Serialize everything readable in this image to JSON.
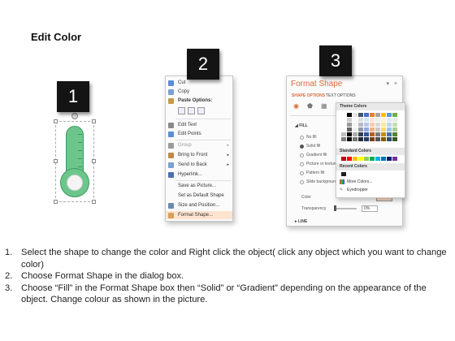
{
  "title": "Edit Color",
  "badges": [
    "1",
    "2",
    "3"
  ],
  "context_menu": {
    "items": [
      {
        "label": "Cut",
        "color": "#5a8ed6"
      },
      {
        "label": "Copy",
        "color": "#7aa0d0"
      },
      {
        "label": "Paste Options:",
        "color": "#c69a4a",
        "bold": true
      },
      {
        "label": "Edit Text",
        "color": "#8a8a8a"
      },
      {
        "label": "Edit Points",
        "color": "#5a8ed6"
      },
      {
        "label": "Group",
        "color": "#9a9a9a",
        "disabled": true,
        "arrow": "▸"
      },
      {
        "label": "Bring to Front",
        "color": "#c08a4a",
        "arrow": "▸"
      },
      {
        "label": "Send to Back",
        "color": "#7aa0d0",
        "arrow": "▸"
      },
      {
        "label": "Hyperlink...",
        "color": "#4a70b0"
      },
      {
        "label": "Save as Picture...",
        "color": ""
      },
      {
        "label": "Set as Default Shape",
        "color": ""
      },
      {
        "label": "Size and Position...",
        "color": "#6a8ab0"
      },
      {
        "label": "Format Shape...",
        "color": "#d8a05a",
        "highlight": true
      }
    ]
  },
  "format_pane": {
    "title": "Format Shape",
    "controls": "▾ ×",
    "tabs": [
      "SHAPE OPTIONS",
      "TEXT OPTIONS"
    ],
    "fill_section": "◢ FILL",
    "fill_options": [
      "No fill",
      "Solid fill",
      "Gradient fill",
      "Picture or texture fill",
      "Pattern fill",
      "Slide background fill"
    ],
    "selected_fill": 1,
    "color_label": "Color",
    "transparency_label": "Transparency",
    "transparency_value": "0%",
    "line_section": "▸ LINE"
  },
  "color_popup": {
    "theme_header": "Theme Colors",
    "standard_header": "Standard Colors",
    "recent_header": "Recent Colors",
    "more_colors": "More Colors...",
    "eyedropper": "Eyedropper",
    "theme_top": [
      "#ffffff",
      "#000000",
      "#e7e6e6",
      "#44546a",
      "#4472c4",
      "#ed7d31",
      "#a5a5a5",
      "#ffc000",
      "#5b9bd5",
      "#70ad47"
    ],
    "standard": [
      "#c00000",
      "#ff0000",
      "#ffc000",
      "#ffff00",
      "#92d050",
      "#00b050",
      "#00b0f0",
      "#0070c0",
      "#002060",
      "#7030a0"
    ],
    "recent": [
      "#1f1f1f"
    ]
  },
  "instructions": [
    {
      "num": "1.",
      "text": "Select the shape to change the color and Right click the object( click any object which you want to change color)"
    },
    {
      "num": "2.",
      "text": "Choose Format Shape in the dialog box."
    },
    {
      "num": "3.",
      "text": "Choose “Fill” in the Format Shape box then “Solid” or “Gradient” depending on the appearance of the object. Change colour as shown in the picture."
    }
  ]
}
